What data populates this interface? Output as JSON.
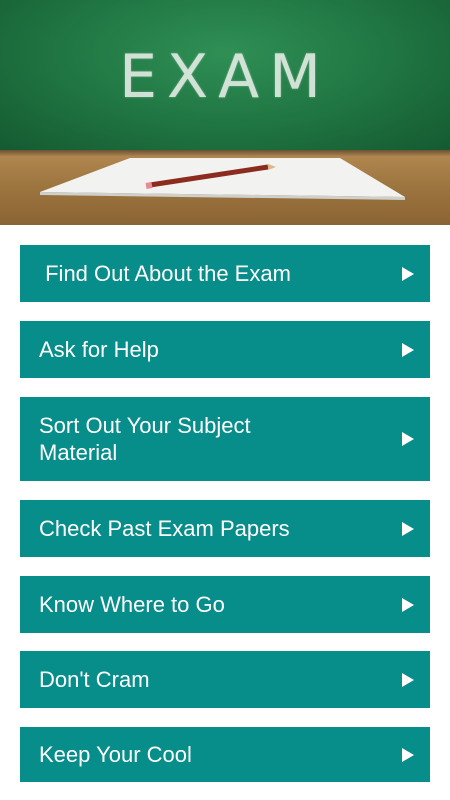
{
  "hero": {
    "board_word": "EXAM"
  },
  "menu": {
    "items": [
      {
        "label": " Find Out About the Exam"
      },
      {
        "label": "Ask for Help"
      },
      {
        "label": "Sort Out Your Subject Material"
      },
      {
        "label": "Check Past Exam Papers"
      },
      {
        "label": "Know Where to Go"
      },
      {
        "label": "Don't Cram"
      },
      {
        "label": "Keep Your Cool"
      }
    ]
  },
  "colors": {
    "button_bg": "#078d8a",
    "button_text": "#ffffff",
    "chalkboard": "#1f7441",
    "desk": "#9e7640"
  },
  "icons": {
    "item_arrow": "play-arrow-icon"
  }
}
